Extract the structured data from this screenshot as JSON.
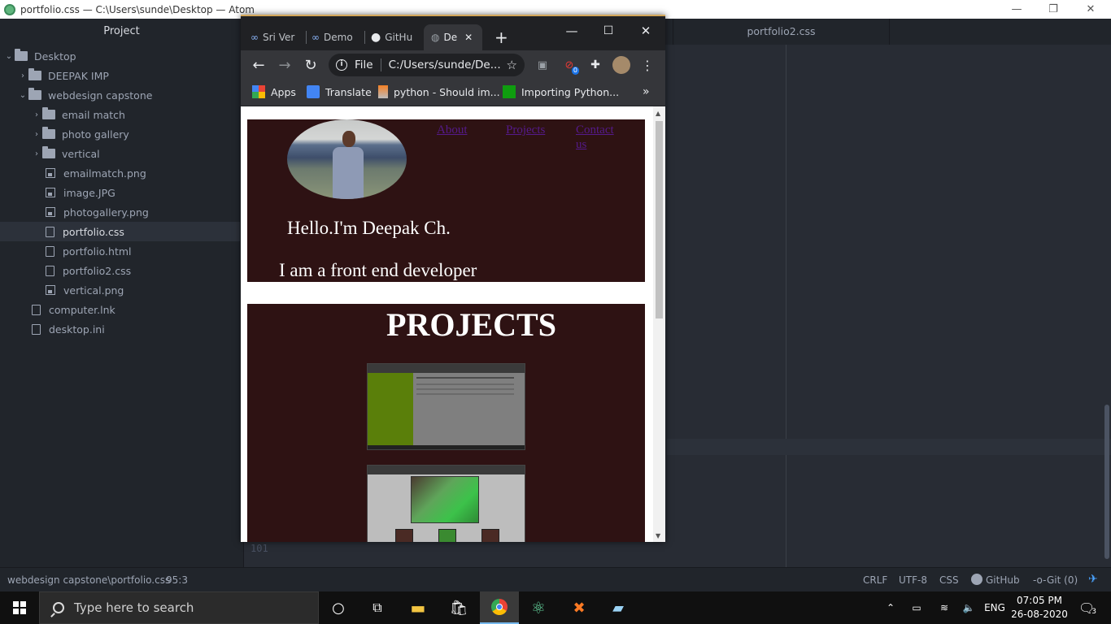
{
  "atom": {
    "window_title": "portfolio.css — C:\\Users\\sunde\\Desktop — Atom",
    "tree_header": "Project",
    "tree": [
      {
        "label": "Desktop",
        "type": "folder",
        "expanded": true,
        "level": 0
      },
      {
        "label": "DEEPAK IMP",
        "type": "folder",
        "expanded": false,
        "level": 1
      },
      {
        "label": "webdesign capstone",
        "type": "folder",
        "expanded": true,
        "level": 1
      },
      {
        "label": "email match",
        "type": "folder",
        "expanded": false,
        "level": 2
      },
      {
        "label": "photo gallery",
        "type": "folder",
        "expanded": false,
        "level": 2
      },
      {
        "label": "vertical",
        "type": "folder",
        "expanded": false,
        "level": 2
      },
      {
        "label": "emailmatch.png",
        "type": "image",
        "level": 2
      },
      {
        "label": "image.JPG",
        "type": "image",
        "level": 2
      },
      {
        "label": "photogallery.png",
        "type": "image",
        "level": 2
      },
      {
        "label": "portfolio.css",
        "type": "file",
        "level": 2,
        "selected": true
      },
      {
        "label": "portfolio.html",
        "type": "file",
        "level": 2
      },
      {
        "label": "portfolio2.css",
        "type": "file",
        "level": 2
      },
      {
        "label": "vertical.png",
        "type": "image",
        "level": 2
      },
      {
        "label": "computer.lnk",
        "type": "file",
        "level": 1
      },
      {
        "label": "desktop.ini",
        "type": "file",
        "level": 1
      }
    ],
    "editor_tab": "portfolio2.css",
    "line_number": "101",
    "status": {
      "path": "webdesign capstone\\portfolio.css",
      "cursor": "95:3",
      "line_ending": "CRLF",
      "encoding": "UTF-8",
      "grammar": "CSS",
      "github": "GitHub",
      "git": "Git (0)"
    }
  },
  "chrome": {
    "tabs": [
      {
        "label": "Sri Ver",
        "icon": "infinity-icon"
      },
      {
        "label": "Demo",
        "icon": "infinity-icon"
      },
      {
        "label": "GitHu",
        "icon": "github-icon"
      },
      {
        "label": "De",
        "icon": "globe-icon",
        "active": true
      }
    ],
    "omnibox": {
      "scheme": "File",
      "url": "C:/Users/sunde/De..."
    },
    "bookmarks": [
      {
        "label": "Apps",
        "icon": "apps-grid-icon"
      },
      {
        "label": "Translate",
        "icon": "translate-icon"
      },
      {
        "label": "python - Should im...",
        "icon": "stackoverflow-icon"
      },
      {
        "label": "Importing Python...",
        "icon": "green-square-icon"
      }
    ],
    "extension_badge": "0",
    "page": {
      "nav": [
        "About",
        "Projects",
        "Contact us"
      ],
      "greeting": "Hello.I'm Deepak Ch.",
      "role": "I am a front end developer",
      "projects_title": "PROJECTS"
    }
  },
  "taskbar": {
    "search_placeholder": "Type here to search",
    "language": "ENG",
    "time": "07:05 PM",
    "date": "26-08-2020",
    "notifications": "3"
  },
  "colors": {
    "hero_bg": "#2e1213",
    "link_visited": "#551a8b",
    "atom_bg": "#21252b",
    "editor_bg": "#282c34"
  }
}
